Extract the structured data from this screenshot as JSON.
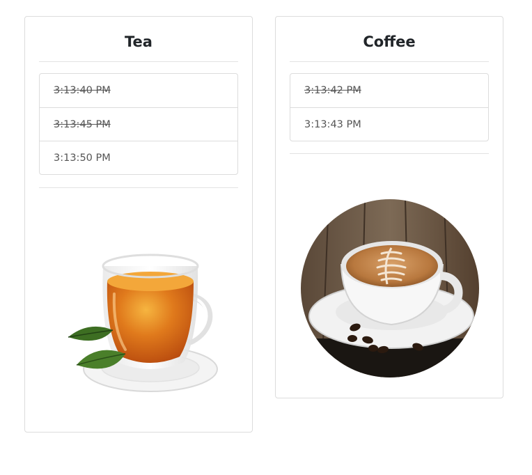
{
  "panels": [
    {
      "title": "Tea",
      "items": [
        {
          "time": "3:13:40 PM",
          "done": true
        },
        {
          "time": "3:13:45 PM",
          "done": true
        },
        {
          "time": "3:13:50 PM",
          "done": false
        }
      ],
      "image": "tea-cup-illustration"
    },
    {
      "title": "Coffee",
      "items": [
        {
          "time": "3:13:42 PM",
          "done": true
        },
        {
          "time": "3:13:43 PM",
          "done": false
        }
      ],
      "image": "coffee-cup-illustration"
    }
  ],
  "colors": {
    "border": "#dcdcdc",
    "text": "#555555",
    "title": "#212529",
    "tea": "#d96a18",
    "coffee_foam": "#c58a4f",
    "wood": "#6e5a47"
  }
}
